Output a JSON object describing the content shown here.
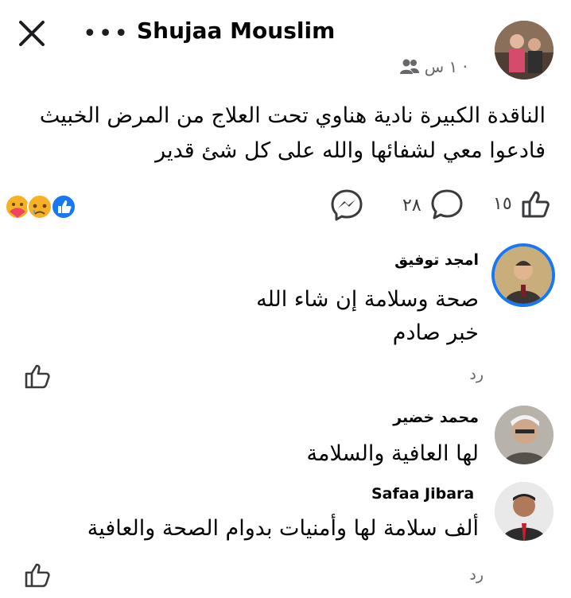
{
  "header": {
    "author": "Shujaa Mouslim",
    "time": "١ س ·"
  },
  "post": {
    "line1": "الناقدة الكبيرة نادية هناوي تحت العلاج من المرض الخبيث",
    "line2": "فادعوا معي لشفائها والله على كل شئ قدير",
    "like_count": "١٥",
    "comment_count": "٢٨"
  },
  "comments": [
    {
      "name": "امجد توفيق",
      "lines": [
        "صحة وسلامة إن شاء الله",
        "خبر صادم"
      ],
      "reply": "رد"
    },
    {
      "name": "محمد خضير",
      "lines": [
        "لها العافية والسلامة"
      ]
    },
    {
      "name": "Safaa Jibara",
      "lines": [
        "ألف سلامة لها وأمنيات بدوام الصحة والعافية"
      ],
      "reply": "رد"
    }
  ],
  "colors": {
    "accent": "#1877f2",
    "secondary_text": "#65676b"
  }
}
